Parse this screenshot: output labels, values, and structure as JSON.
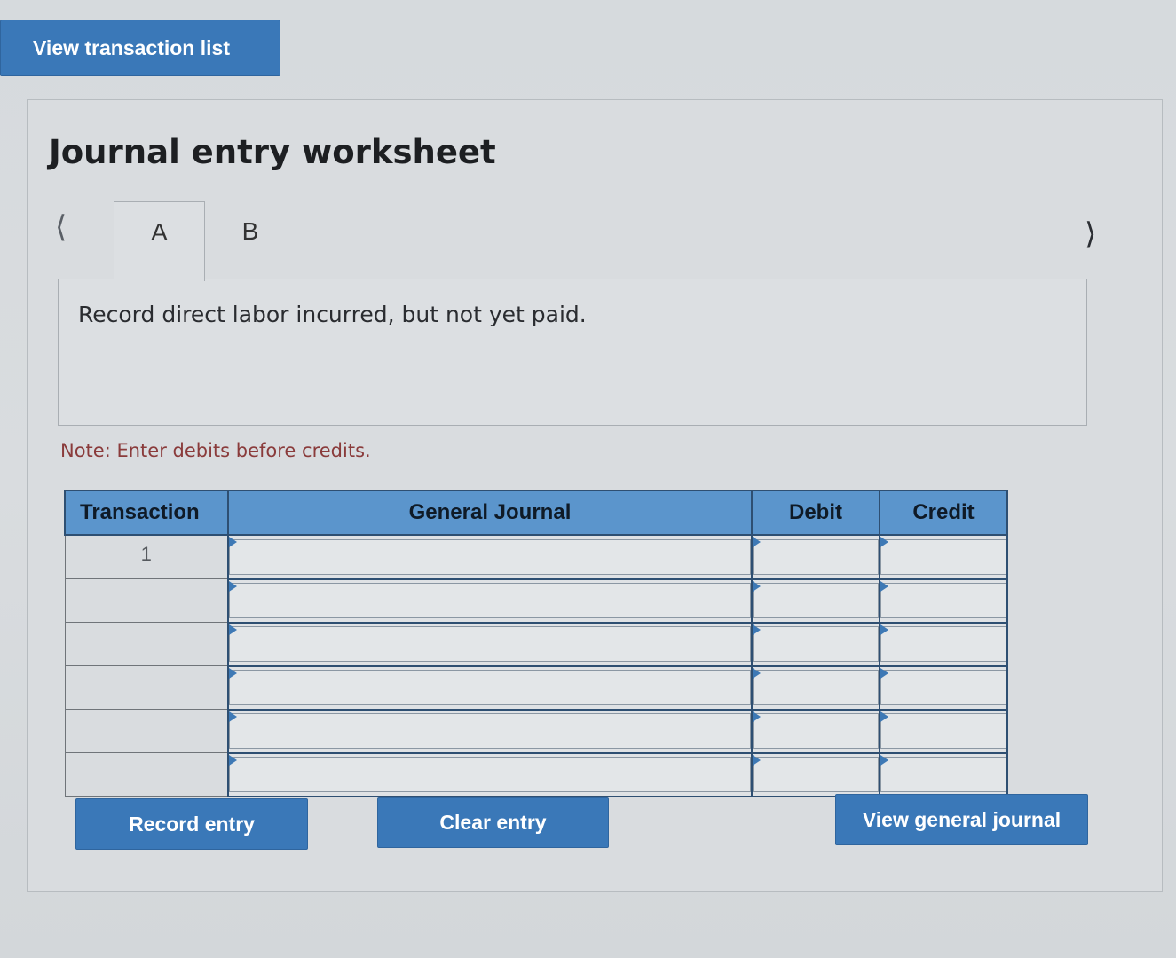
{
  "header": {
    "view_list_label": "View transaction list"
  },
  "worksheet": {
    "title": "Journal entry worksheet",
    "prev_icon": "chevron-left-icon",
    "next_icon": "chevron-right-icon",
    "tabs": [
      {
        "label": "A",
        "active": true
      },
      {
        "label": "B",
        "active": false
      }
    ],
    "description": "Record direct labor incurred, but not yet paid.",
    "note": "Note: Enter debits before credits."
  },
  "table": {
    "headers": {
      "transaction": "Transaction",
      "general_journal": "General Journal",
      "debit": "Debit",
      "credit": "Credit"
    },
    "rows": [
      {
        "transaction": "1",
        "account": "",
        "debit": "",
        "credit": ""
      },
      {
        "transaction": "",
        "account": "",
        "debit": "",
        "credit": ""
      },
      {
        "transaction": "",
        "account": "",
        "debit": "",
        "credit": ""
      },
      {
        "transaction": "",
        "account": "",
        "debit": "",
        "credit": ""
      },
      {
        "transaction": "",
        "account": "",
        "debit": "",
        "credit": ""
      },
      {
        "transaction": "",
        "account": "",
        "debit": "",
        "credit": ""
      }
    ]
  },
  "actions": {
    "record_label": "Record entry",
    "clear_label": "Clear entry",
    "view_journal_label": "View general journal"
  },
  "colors": {
    "button_blue": "#3a78b8",
    "header_blue": "#5b95cc",
    "note_red": "#8a3b3b"
  }
}
